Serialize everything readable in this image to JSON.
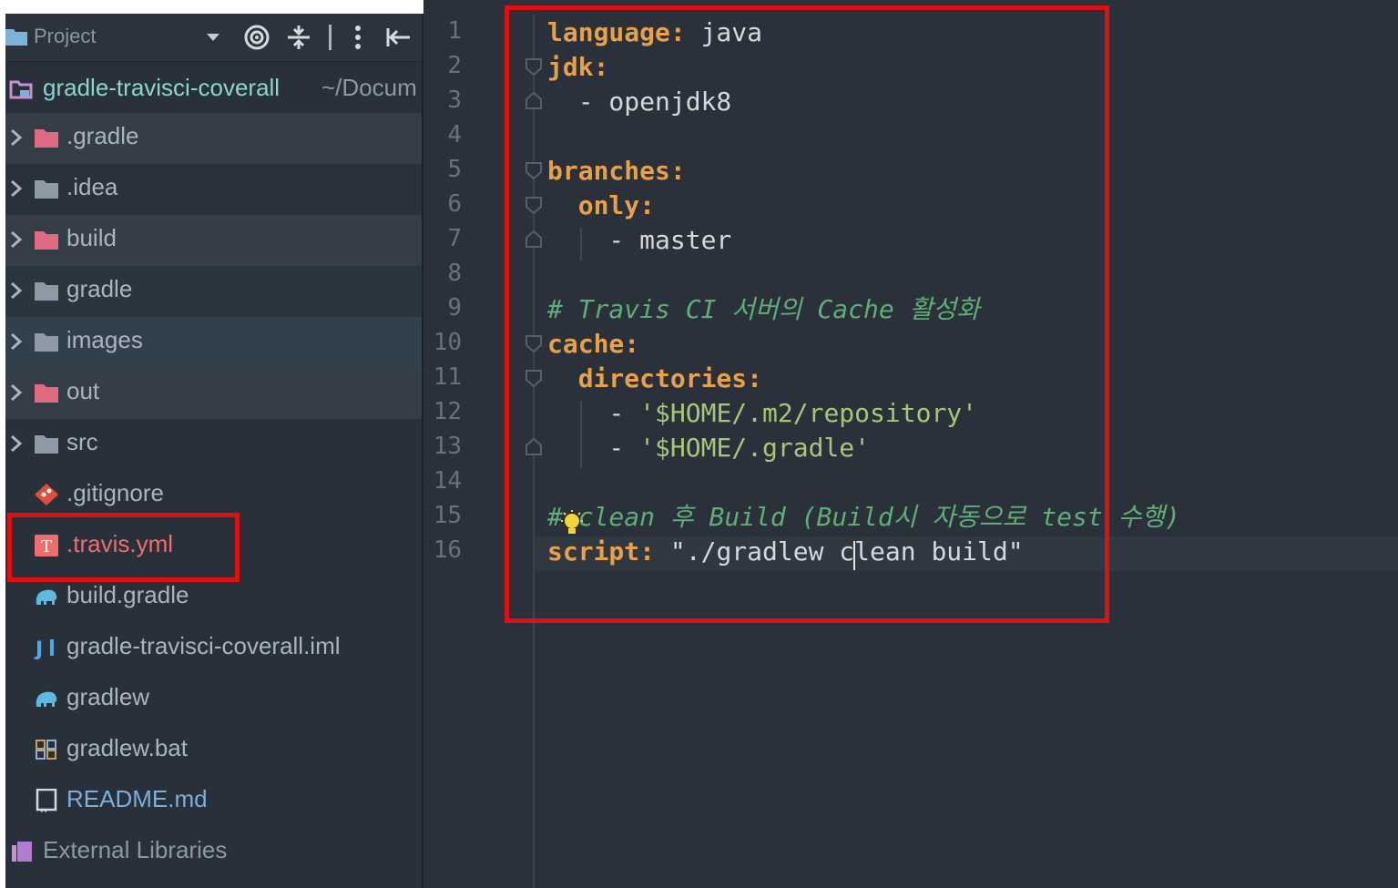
{
  "sidebar": {
    "title": "Project",
    "root": {
      "name": "gradle-travisci-coverall",
      "path": "~/Docum"
    },
    "items": [
      {
        "name": ".gradle",
        "icon": "folder-red-icon",
        "arrow": true,
        "bg": "#353e47",
        "color": "#aab4be"
      },
      {
        "name": ".idea",
        "icon": "folder-icon",
        "arrow": true,
        "bg": "#29323b",
        "color": "#aab4be"
      },
      {
        "name": "build",
        "icon": "folder-red-icon",
        "arrow": true,
        "bg": "#353e47",
        "color": "#aab4be"
      },
      {
        "name": "gradle",
        "icon": "folder-icon",
        "arrow": true,
        "bg": "#2b3540",
        "color": "#aab4be"
      },
      {
        "name": "images",
        "icon": "folder-icon",
        "arrow": true,
        "bg": "#31404c",
        "color": "#aab4be"
      },
      {
        "name": "out",
        "icon": "folder-red-icon",
        "arrow": true,
        "bg": "#353e47",
        "color": "#aab4be"
      },
      {
        "name": "src",
        "icon": "folder-icon",
        "arrow": true,
        "bg": "#28313a",
        "color": "#aab4be"
      },
      {
        "name": ".gitignore",
        "icon": "git-icon",
        "arrow": false,
        "bg": "#28313a",
        "color": "#aab4be"
      },
      {
        "name": ".travis.yml",
        "icon": "travis-icon",
        "arrow": false,
        "bg": "#28313a",
        "color": "#ee6e6e"
      },
      {
        "name": "build.gradle",
        "icon": "gradle-elephant-icon",
        "arrow": false,
        "bg": "#28313a",
        "color": "#aab4be"
      },
      {
        "name": "gradle-travisci-coverall.iml",
        "icon": "intellij-module-icon",
        "arrow": false,
        "bg": "#28313a",
        "color": "#aab4be"
      },
      {
        "name": "gradlew",
        "icon": "gradle-elephant-icon",
        "arrow": false,
        "bg": "#28313a",
        "color": "#aab4be"
      },
      {
        "name": "gradlew.bat",
        "icon": "windows-script-icon",
        "arrow": false,
        "bg": "#28313a",
        "color": "#aab4be"
      },
      {
        "name": "README.md",
        "icon": "markdown-book-icon",
        "arrow": false,
        "bg": "#28313a",
        "color": "#7aaedb"
      },
      {
        "name": "External Libraries",
        "icon": "library-icon",
        "arrow": false,
        "bg": "#28313a",
        "color": "#8d98a3"
      }
    ]
  },
  "editor": {
    "lines": [
      {
        "no": "1",
        "tokens": [
          [
            "k",
            "language:"
          ],
          [
            "v",
            " java"
          ]
        ]
      },
      {
        "no": "2",
        "tokens": [
          [
            "k",
            "jdk:"
          ]
        ]
      },
      {
        "no": "3",
        "tokens": [
          [
            "v",
            "  - openjdk8"
          ]
        ]
      },
      {
        "no": "4",
        "tokens": []
      },
      {
        "no": "5",
        "tokens": [
          [
            "k",
            "branches:"
          ]
        ]
      },
      {
        "no": "6",
        "tokens": [
          [
            "k",
            "  only:"
          ]
        ]
      },
      {
        "no": "7",
        "tokens": [
          [
            "v",
            "    - master"
          ]
        ]
      },
      {
        "no": "8",
        "tokens": []
      },
      {
        "no": "9",
        "tokens": [
          [
            "c",
            "# Travis CI 서버의 Cache 활성화"
          ]
        ]
      },
      {
        "no": "10",
        "tokens": [
          [
            "k",
            "cache:"
          ]
        ]
      },
      {
        "no": "11",
        "tokens": [
          [
            "k",
            "  directories:"
          ]
        ]
      },
      {
        "no": "12",
        "tokens": [
          [
            "v",
            "    - "
          ],
          [
            "s",
            "'$HOME/.m2/repository'"
          ]
        ]
      },
      {
        "no": "13",
        "tokens": [
          [
            "v",
            "    - "
          ],
          [
            "s",
            "'$HOME/.gradle'"
          ]
        ]
      },
      {
        "no": "14",
        "tokens": []
      },
      {
        "no": "15",
        "tokens": [
          [
            "c",
            "# clean 후 Build (Build시 자동으로 test 수행)"
          ]
        ]
      },
      {
        "no": "16",
        "tokens": [
          [
            "k",
            "script:"
          ],
          [
            "v",
            " \"./gradlew clean build\""
          ]
        ]
      }
    ]
  },
  "colors": {
    "highlight_box": "#e01010",
    "keyword": "#e7a04c",
    "string": "#a7c777",
    "comment": "#5fae77"
  }
}
